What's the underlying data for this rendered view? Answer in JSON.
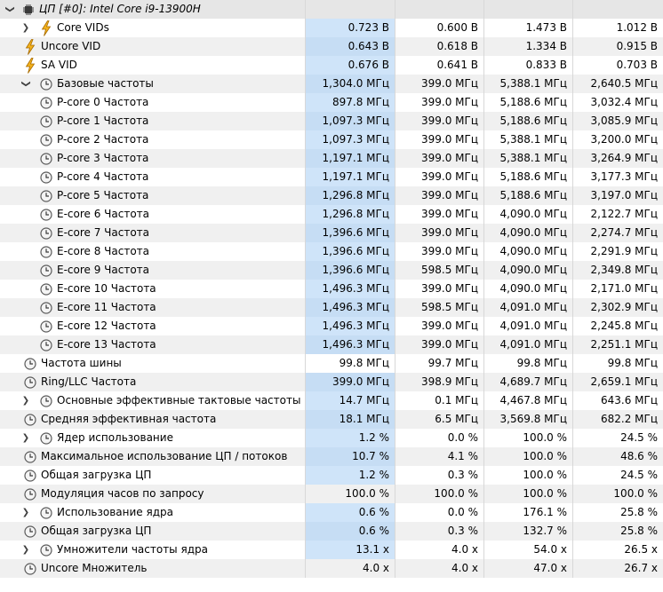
{
  "colors": {
    "highlight": "#cfe4f9",
    "alt_row": "#f0f0f0",
    "header_row": "#e6e6e6"
  },
  "rows": [
    {
      "label": "ЦП [#0]: Intel Core i9-13900H",
      "icon": "cpu-icon",
      "level": 0,
      "expander": "expanded",
      "kind": "header",
      "values": [
        "",
        "",
        "",
        ""
      ]
    },
    {
      "label": "Core VIDs",
      "icon": "voltage-icon",
      "level": 1,
      "expander": "collapsed",
      "hl": true,
      "values": [
        "0.723 В",
        "0.600 В",
        "1.473 В",
        "1.012 В"
      ]
    },
    {
      "label": "Uncore VID",
      "icon": "voltage-icon",
      "level": 0,
      "expander": "none",
      "hl": true,
      "values": [
        "0.643 В",
        "0.618 В",
        "1.334 В",
        "0.915 В"
      ]
    },
    {
      "label": "SA VID",
      "icon": "voltage-icon",
      "level": 0,
      "expander": "none",
      "hl": true,
      "values": [
        "0.676 В",
        "0.641 В",
        "0.833 В",
        "0.703 В"
      ]
    },
    {
      "label": "Базовые частоты",
      "icon": "clock-icon",
      "level": 1,
      "expander": "expanded",
      "hl": true,
      "values": [
        "1,304.0 МГц",
        "399.0 МГц",
        "5,388.1 МГц",
        "2,640.5 МГц"
      ]
    },
    {
      "label": "P-core 0 Частота",
      "icon": "clock-icon",
      "level": 2,
      "expander": "none",
      "hl": true,
      "values": [
        "897.8 МГц",
        "399.0 МГц",
        "5,188.6 МГц",
        "3,032.4 МГц"
      ]
    },
    {
      "label": "P-core 1 Частота",
      "icon": "clock-icon",
      "level": 2,
      "expander": "none",
      "hl": true,
      "values": [
        "1,097.3 МГц",
        "399.0 МГц",
        "5,188.6 МГц",
        "3,085.9 МГц"
      ]
    },
    {
      "label": "P-core 2 Частота",
      "icon": "clock-icon",
      "level": 2,
      "expander": "none",
      "hl": true,
      "values": [
        "1,097.3 МГц",
        "399.0 МГц",
        "5,388.1 МГц",
        "3,200.0 МГц"
      ]
    },
    {
      "label": "P-core 3 Частота",
      "icon": "clock-icon",
      "level": 2,
      "expander": "none",
      "hl": true,
      "values": [
        "1,197.1 МГц",
        "399.0 МГц",
        "5,388.1 МГц",
        "3,264.9 МГц"
      ]
    },
    {
      "label": "P-core 4 Частота",
      "icon": "clock-icon",
      "level": 2,
      "expander": "none",
      "hl": true,
      "values": [
        "1,197.1 МГц",
        "399.0 МГц",
        "5,188.6 МГц",
        "3,177.3 МГц"
      ]
    },
    {
      "label": "P-core 5 Частота",
      "icon": "clock-icon",
      "level": 2,
      "expander": "none",
      "hl": true,
      "values": [
        "1,296.8 МГц",
        "399.0 МГц",
        "5,188.6 МГц",
        "3,197.0 МГц"
      ]
    },
    {
      "label": "E-core 6 Частота",
      "icon": "clock-icon",
      "level": 2,
      "expander": "none",
      "hl": true,
      "values": [
        "1,296.8 МГц",
        "399.0 МГц",
        "4,090.0 МГц",
        "2,122.7 МГц"
      ]
    },
    {
      "label": "E-core 7 Частота",
      "icon": "clock-icon",
      "level": 2,
      "expander": "none",
      "hl": true,
      "values": [
        "1,396.6 МГц",
        "399.0 МГц",
        "4,090.0 МГц",
        "2,274.7 МГц"
      ]
    },
    {
      "label": "E-core 8 Частота",
      "icon": "clock-icon",
      "level": 2,
      "expander": "none",
      "hl": true,
      "values": [
        "1,396.6 МГц",
        "399.0 МГц",
        "4,090.0 МГц",
        "2,291.9 МГц"
      ]
    },
    {
      "label": "E-core 9 Частота",
      "icon": "clock-icon",
      "level": 2,
      "expander": "none",
      "hl": true,
      "values": [
        "1,396.6 МГц",
        "598.5 МГц",
        "4,090.0 МГц",
        "2,349.8 МГц"
      ]
    },
    {
      "label": "E-core 10 Частота",
      "icon": "clock-icon",
      "level": 2,
      "expander": "none",
      "hl": true,
      "values": [
        "1,496.3 МГц",
        "399.0 МГц",
        "4,090.0 МГц",
        "2,171.0 МГц"
      ]
    },
    {
      "label": "E-core 11 Частота",
      "icon": "clock-icon",
      "level": 2,
      "expander": "none",
      "hl": true,
      "values": [
        "1,496.3 МГц",
        "598.5 МГц",
        "4,091.0 МГц",
        "2,302.9 МГц"
      ]
    },
    {
      "label": "E-core 12 Частота",
      "icon": "clock-icon",
      "level": 2,
      "expander": "none",
      "hl": true,
      "values": [
        "1,496.3 МГц",
        "399.0 МГц",
        "4,091.0 МГц",
        "2,245.8 МГц"
      ]
    },
    {
      "label": "E-core 13 Частота",
      "icon": "clock-icon",
      "level": 2,
      "expander": "none",
      "hl": true,
      "values": [
        "1,496.3 МГц",
        "399.0 МГц",
        "4,091.0 МГц",
        "2,251.1 МГц"
      ]
    },
    {
      "label": "Частота шины",
      "icon": "clock-icon",
      "level": 0,
      "expander": "none",
      "hl": false,
      "values": [
        "99.8 МГц",
        "99.7 МГц",
        "99.8 МГц",
        "99.8 МГц"
      ]
    },
    {
      "label": "Ring/LLC Частота",
      "icon": "clock-icon",
      "level": 0,
      "expander": "none",
      "hl": true,
      "values": [
        "399.0 МГц",
        "398.9 МГц",
        "4,689.7 МГц",
        "2,659.1 МГц"
      ]
    },
    {
      "label": "Основные эффективные тактовые частоты",
      "icon": "clock-icon",
      "level": 1,
      "expander": "collapsed",
      "hl": true,
      "values": [
        "14.7 МГц",
        "0.1 МГц",
        "4,467.8 МГц",
        "643.6 МГц"
      ]
    },
    {
      "label": "Средняя эффективная частота",
      "icon": "clock-icon",
      "level": 0,
      "expander": "none",
      "hl": true,
      "values": [
        "18.1 МГц",
        "6.5 МГц",
        "3,569.8 МГц",
        "682.2 МГц"
      ]
    },
    {
      "label": "Ядер использование",
      "icon": "clock-icon",
      "level": 1,
      "expander": "collapsed",
      "hl": true,
      "values": [
        "1.2 %",
        "0.0 %",
        "100.0 %",
        "24.5 %"
      ]
    },
    {
      "label": "Максимальное использование ЦП / потоков",
      "icon": "clock-icon",
      "level": 0,
      "expander": "none",
      "hl": true,
      "values": [
        "10.7 %",
        "4.1 %",
        "100.0 %",
        "48.6 %"
      ]
    },
    {
      "label": "Общая загрузка ЦП",
      "icon": "clock-icon",
      "level": 0,
      "expander": "none",
      "hl": true,
      "values": [
        "1.2 %",
        "0.3 %",
        "100.0 %",
        "24.5 %"
      ]
    },
    {
      "label": "Модуляция часов по запросу",
      "icon": "clock-icon",
      "level": 0,
      "expander": "none",
      "hl": false,
      "values": [
        "100.0 %",
        "100.0 %",
        "100.0 %",
        "100.0 %"
      ]
    },
    {
      "label": "Использование ядра",
      "icon": "clock-icon",
      "level": 1,
      "expander": "collapsed",
      "hl": true,
      "values": [
        "0.6 %",
        "0.0 %",
        "176.1 %",
        "25.8 %"
      ]
    },
    {
      "label": "Общая загрузка ЦП",
      "icon": "clock-icon",
      "level": 0,
      "expander": "none",
      "hl": true,
      "values": [
        "0.6 %",
        "0.3 %",
        "132.7 %",
        "25.8 %"
      ]
    },
    {
      "label": "Умножители частоты ядра",
      "icon": "clock-icon",
      "level": 1,
      "expander": "collapsed",
      "hl": true,
      "values": [
        "13.1 x",
        "4.0 x",
        "54.0 x",
        "26.5 x"
      ]
    },
    {
      "label": "Uncore Множитель",
      "icon": "clock-icon",
      "level": 0,
      "expander": "none",
      "hl": false,
      "values": [
        "4.0 x",
        "4.0 x",
        "47.0 x",
        "26.7 x"
      ]
    }
  ]
}
